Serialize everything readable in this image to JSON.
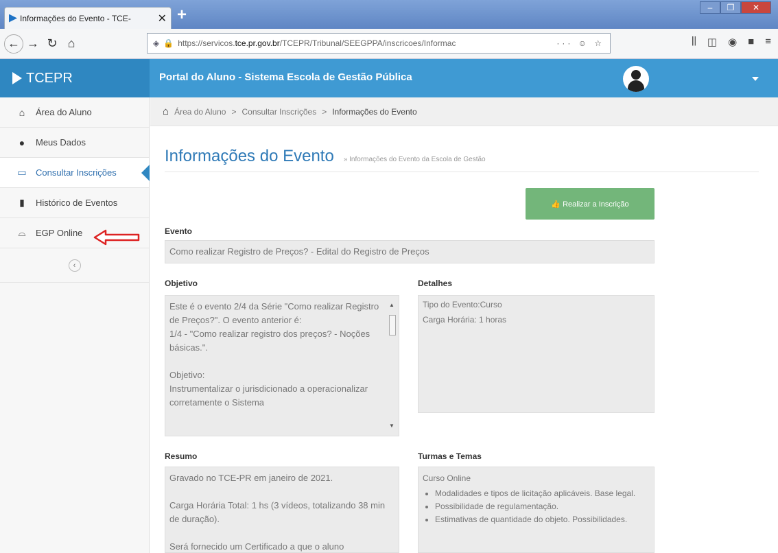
{
  "browser": {
    "tab_title": "Informações do Evento - TCE-",
    "tab_close": "✕",
    "new_tab": "+",
    "url_host_pre": "https://servicos.",
    "url_host_bold": "tce.pr.gov.br",
    "url_path": "/TCEPR/Tribunal/SEEGPPA/inscricoes/Informac",
    "url_tools": "··· ☺ ☆",
    "right_icons": [
      "⫼",
      "◫",
      "◉",
      "■",
      "≡"
    ]
  },
  "header": {
    "brand": "TCEPR",
    "title": "Portal do Aluno - Sistema Escola de Gestão Pública"
  },
  "sidebar": {
    "items": [
      {
        "label": "Área do Aluno",
        "icon": "home-icon",
        "glyph": "⌂"
      },
      {
        "label": "Meus Dados",
        "icon": "user-icon",
        "glyph": "●"
      },
      {
        "label": "Consultar Inscrições",
        "icon": "laptop-icon",
        "glyph": "▭"
      },
      {
        "label": "Histórico de Eventos",
        "icon": "book-icon",
        "glyph": "▮"
      },
      {
        "label": "EGP Online",
        "icon": "graduation-cap-icon",
        "glyph": "⌓"
      }
    ],
    "collapse_glyph": "‹"
  },
  "breadcrumb": {
    "items": [
      "Área do Aluno",
      "Consultar Inscrições",
      "Informações do Evento"
    ],
    "sep": ">"
  },
  "page": {
    "title": "Informações do Evento",
    "subtitle": "» Informações do Evento da Escola de Gestão",
    "button": "👍 Realizar a Inscrição",
    "evento_label": "Evento",
    "evento_value": "Como realizar Registro de Preços? - Edital do Registro de Preços",
    "objetivo_label": "Objetivo",
    "objetivo_p1": "Este é o evento 2/4 da Série \"Como realizar Registro de Preços?\". O evento anterior é:",
    "objetivo_p2": "1/4 - \"Como realizar registro dos preços? - Noções básicas.\".",
    "objetivo_p3": "Objetivo:",
    "objetivo_p4": "Instrumentalizar o jurisdicionado a operacionalizar corretamente o Sistema",
    "detalhes_label": "Detalhes",
    "detalhes_l1": "Tipo do Evento:Curso",
    "detalhes_l2": "Carga Horária: 1 horas",
    "resumo_label": "Resumo",
    "resumo_p1": "Gravado no TCE-PR em janeiro de 2021.",
    "resumo_p2": "Carga Horária Total: 1 hs (3 vídeos, totalizando 38 min de duração).",
    "resumo_p3": "Será fornecido um Certificado a que o aluno",
    "turmas_label": "Turmas e Temas",
    "turmas_head": "Curso Online",
    "turmas_items": [
      "Modalidades e tipos de licitação aplicáveis. Base legal.",
      "Possibilidade de regulamentação.",
      "Estimativas de quantidade do objeto. Possibilidades."
    ]
  }
}
